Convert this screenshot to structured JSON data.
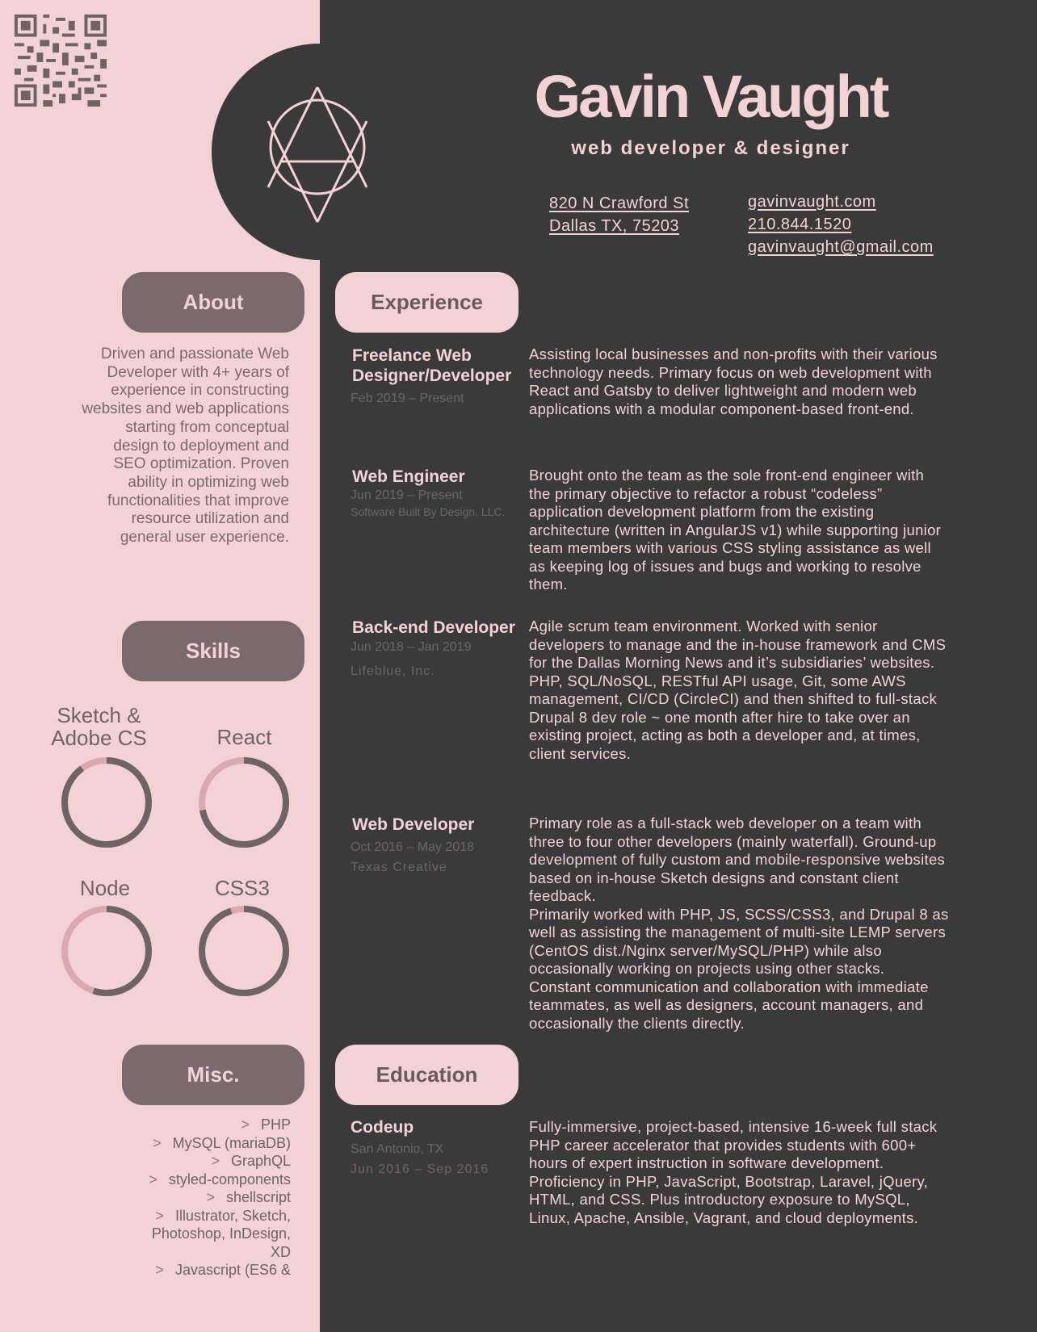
{
  "header": {
    "name": "Gavin Vaught",
    "subtitle": "web developer & designer",
    "address": [
      "820 N Crawford St",
      "Dallas  TX,  75203"
    ],
    "links": [
      "gavinvaught.com",
      "210.844.1520",
      "gavinvaught@gmail.com"
    ]
  },
  "about": {
    "heading": "About",
    "text": "Driven and passionate Web Developer with 4+ years of experience in constructing websites and web applications starting from conceptual design to deployment and SEO optimization.  Proven ability in optimizing web functionalities that improve resource utilization and general user experience."
  },
  "skills": {
    "heading": "Skills",
    "items": [
      {
        "label": "Sketch &\nAdobe CS",
        "level": 0.9
      },
      {
        "label": "React",
        "level": 0.72
      },
      {
        "label": "Node",
        "level": 0.55
      },
      {
        "label": "CSS3",
        "level": 0.95
      }
    ]
  },
  "misc": {
    "heading": "Misc.",
    "items": [
      {
        "arrow": ">",
        "text": "PHP"
      },
      {
        "arrow": ">",
        "text": "MySQL (mariaDB)"
      },
      {
        "arrow": ">",
        "text": "GraphQL"
      },
      {
        "arrow": ">",
        "text": "styled-components"
      },
      {
        "arrow": ">",
        "text": "shellscript"
      },
      {
        "arrow": ">",
        "text": "Illustrator, Sketch,"
      },
      {
        "arrow": "",
        "text": "Photoshop, InDesign,"
      },
      {
        "arrow": "",
        "text": "XD"
      },
      {
        "arrow": ">",
        "text": "Javascript (ES6 &"
      }
    ]
  },
  "experience": {
    "heading": "Experience",
    "jobs": [
      {
        "title": "Freelance Web Designer/Developer",
        "dates": "Feb 2019 – Present",
        "company": "",
        "desc": "Assisting local businesses and non-profits with their various technology needs.  Primary focus on web development with React and Gatsby to deliver lightweight and modern web applications with a modular component-based front-end."
      },
      {
        "title": "Web Engineer",
        "dates": "Jun 2019 – Present",
        "company": "Software Built By Design, LLC.",
        "desc": "Brought onto the team as the sole front-end engineer with the primary objective to refactor a robust “codeless” application development platform from the existing architecture (written in AngularJS v1) while supporting junior team members with various CSS  styling assistance as well as keeping log of issues and bugs and working to resolve them."
      },
      {
        "title": "Back-end Developer",
        "dates": "Jun 2018 – Jan 2019",
        "company": "Lifeblue, Inc.",
        "desc": "Agile scrum team environment.  Worked with senior developers to manage and the in-house framework and CMS for the Dallas Morning News and it’s subsidiaries’ websites.\nPHP, SQL/NoSQL, RESTful API usage, Git, some AWS management, CI/CD (CircleCI) and then shifted to full-stack Drupal 8 dev role ~ one month after hire to take over an existing project, acting as both a developer and, at times, client services."
      },
      {
        "title": "Web Developer",
        "dates": "Oct 2016 – May 2018",
        "company": "Texas Creative",
        "desc": "Primary role as a full-stack web developer on a team with three to four other developers (mainly waterfall). Ground-up development of fully custom and mobile-responsive websites based on in-house Sketch designs and constant client feedback.\nPrimarily worked with PHP, JS, SCSS/CSS3, and Drupal 8 as well as assisting the management of multi-site LEMP servers (CentOS dist./Nginx server/MySQL/PHP) while also occasionally working on projects using other stacks. Constant communication and collaboration with immediate teammates, as well as designers, account managers, and occasionally the clients directly."
      }
    ]
  },
  "education": {
    "heading": "Education",
    "school": "Codeup",
    "location": "San Antonio, TX",
    "dates": "Jun 2016 – Sep 2016",
    "desc": "Fully-immersive, project-based, intensive 16-week full stack PHP career accelerator that provides students with 600+ hours of expert instruction in software development. Proficiency in PHP, JavaScript, Bootstrap, Laravel, jQuery, HTML, and CSS. Plus introductory exposure to MySQL, Linux, Apache, Ansible, Vagrant, and cloud deployments."
  },
  "colors": {
    "pink": "#f3d2d5",
    "charcoal": "#3b3a3b",
    "mauve": "#7a6a6d",
    "ring_track": "#6e6466",
    "ring_accent": "#d9a9ad"
  }
}
